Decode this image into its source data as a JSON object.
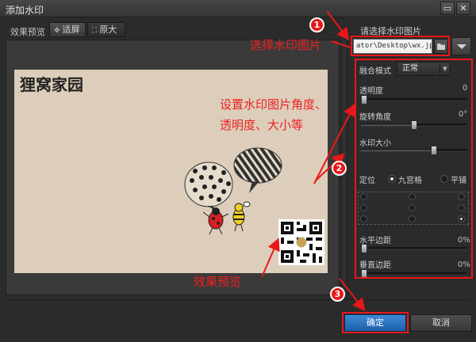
{
  "window": {
    "title": "添加水印",
    "minimize_symbol": "▭",
    "close_symbol": "✕"
  },
  "preview": {
    "label": "效果预览",
    "fit_label": "适屏",
    "original_label": "原大",
    "image_title": "狸窝家园"
  },
  "settings": {
    "choose_label": "请选择水印图片",
    "path": "ator\\Desktop\\wx.jpg",
    "blend_label": "融合模式",
    "blend_value": "正常",
    "opacity_label": "透明度",
    "opacity_value": "0",
    "rotation_label": "旋转角度",
    "rotation_value": "0°",
    "size_label": "水印大小",
    "position_label": "定位",
    "grid_label": "九宫格",
    "tile_label": "平铺",
    "h_margin_label": "水平边距",
    "h_margin_value": "0%",
    "v_margin_label": "垂直边距",
    "v_margin_value": "0%"
  },
  "slider_levels": {
    "opacity": 0.0,
    "rotation": 0.5,
    "size": 0.7,
    "h_margin": 0.0,
    "v_margin": 0.0
  },
  "positions": {
    "selected": "bottom-right"
  },
  "footer": {
    "ok_label": "确定",
    "cancel_label": "取消"
  },
  "annotations": {
    "choose_image": "选择水印图片",
    "set_props_1": "设置水印图片角度、",
    "set_props_2": "透明度、大小等",
    "preview_note": "效果预览",
    "badge_1": "1",
    "badge_2": "2",
    "badge_3": "3",
    "color": "#e81818"
  }
}
